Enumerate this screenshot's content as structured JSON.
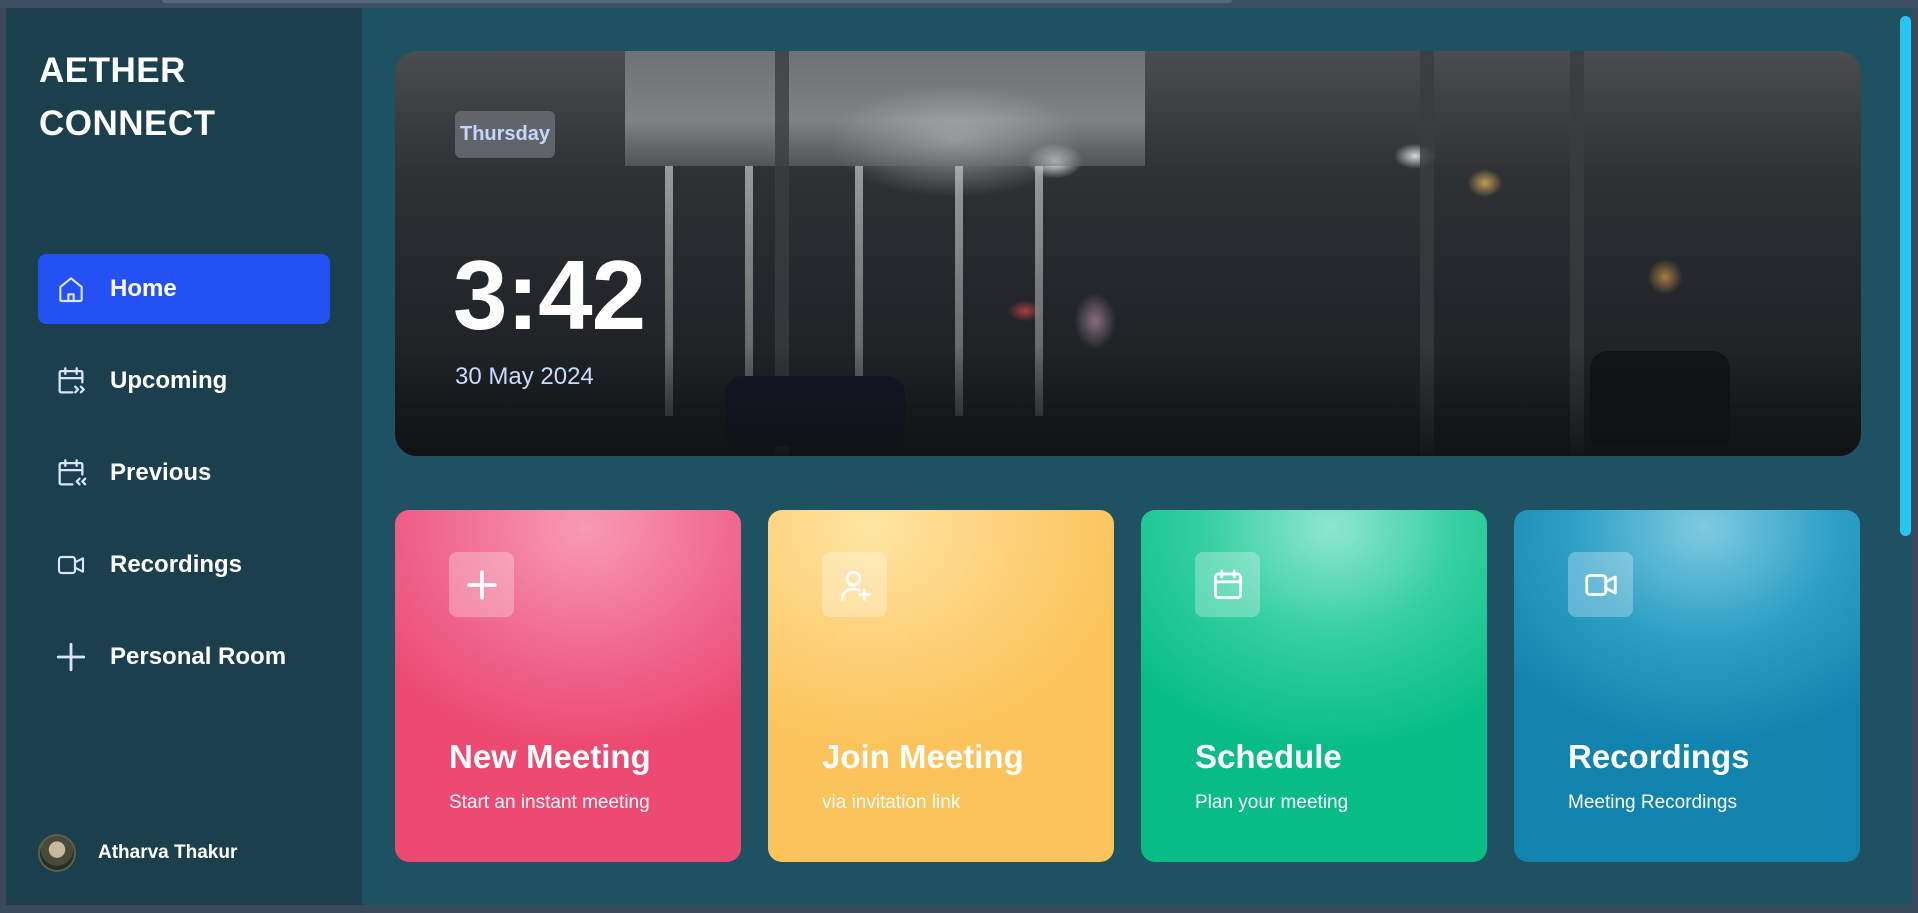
{
  "brand": {
    "line1": "AETHER",
    "line2": "CONNECT"
  },
  "sidebar": {
    "items": [
      {
        "label": "Home",
        "icon": "home-icon",
        "active": true
      },
      {
        "label": "Upcoming",
        "icon": "calendar-forward-icon",
        "active": false
      },
      {
        "label": "Previous",
        "icon": "calendar-back-icon",
        "active": false
      },
      {
        "label": "Recordings",
        "icon": "video-icon",
        "active": false
      },
      {
        "label": "Personal Room",
        "icon": "plus-icon",
        "active": false
      }
    ],
    "user": {
      "name": "Atharva Thakur"
    }
  },
  "hero": {
    "day": "Thursday",
    "time": "3:42",
    "date": "30 May 2024"
  },
  "cards": [
    {
      "title": "New Meeting",
      "subtitle": "Start an instant meeting",
      "icon": "plus-icon",
      "color": "#ee5a80"
    },
    {
      "title": "Join Meeting",
      "subtitle": "via invitation link",
      "icon": "user-add-icon",
      "color": "#fdd07a"
    },
    {
      "title": "Schedule",
      "subtitle": "Plan your meeting",
      "icon": "calendar-icon",
      "color": "#2fcd9c"
    },
    {
      "title": "Recordings",
      "subtitle": "Meeting Recordings",
      "icon": "video-icon",
      "color": "#2a9cc4"
    }
  ],
  "colors": {
    "accent": "#2452f2",
    "sidebar_bg": "#1b3f4d",
    "main_bg": "#1e5161",
    "scrollbar": "#27c6f0"
  }
}
